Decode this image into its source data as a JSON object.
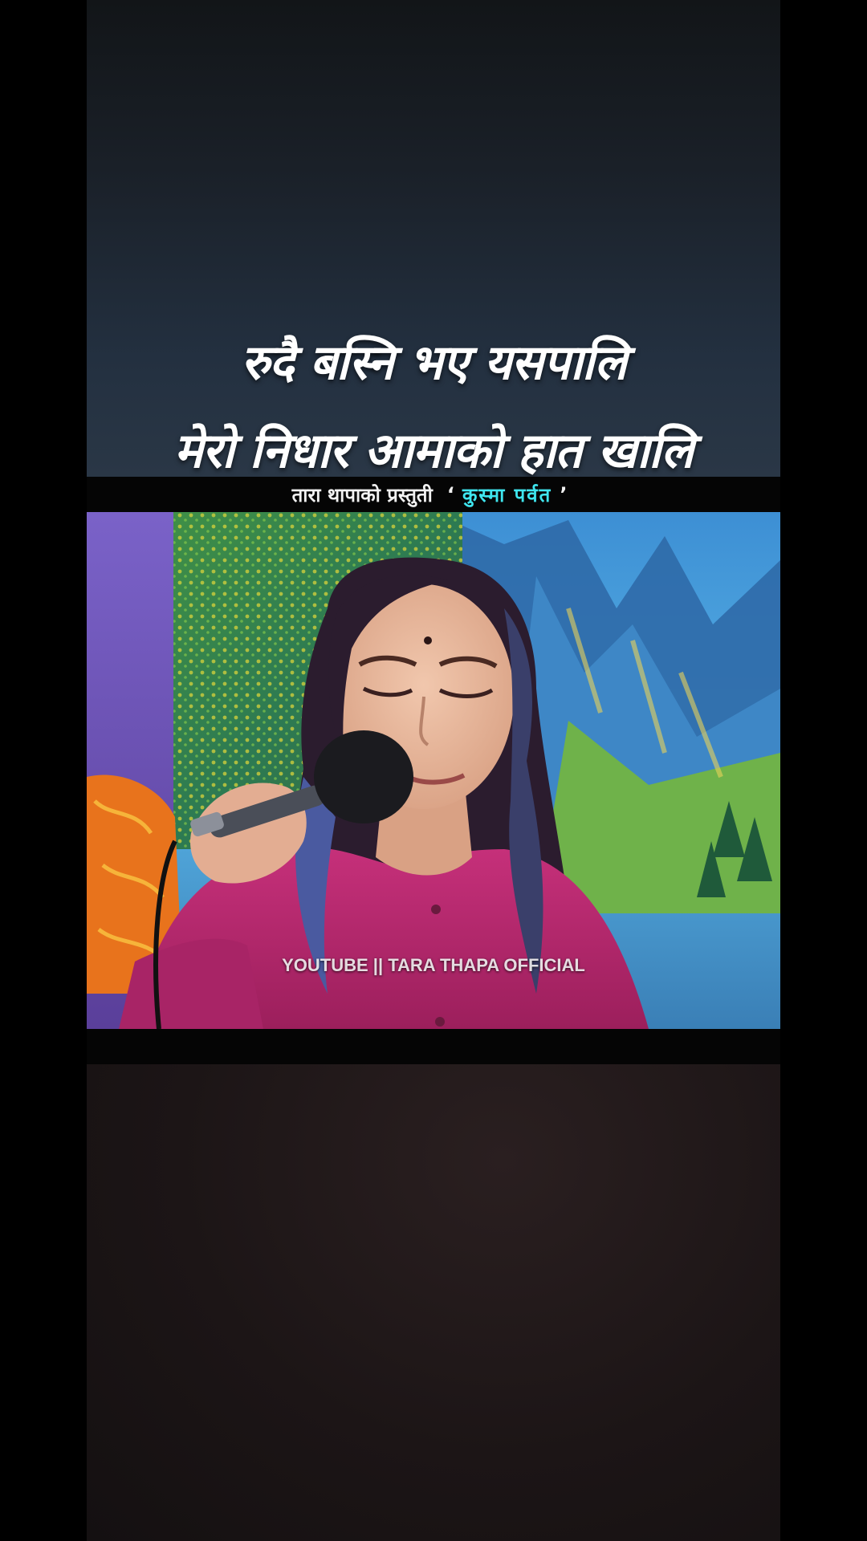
{
  "lyrics": {
    "line1": "रुदै बस्नि भए यसपालि",
    "line2": "मेरो निधार आमाको हात खालि"
  },
  "subtitle": {
    "presenter": "तारा थापाको प्रस्तुती",
    "open_quote": "ʻ",
    "artist": "कुस्मा  पर्वत",
    "close_quote": "ʼ"
  },
  "video": {
    "watermark": "YOUTUBE || TARA THAPA OFFICIAL"
  },
  "colors": {
    "accent_artist": "#3fe6ef",
    "lyric_text": "#ffffff",
    "top_bg": "#1a2028",
    "bottom_bg": "#1c1516"
  }
}
